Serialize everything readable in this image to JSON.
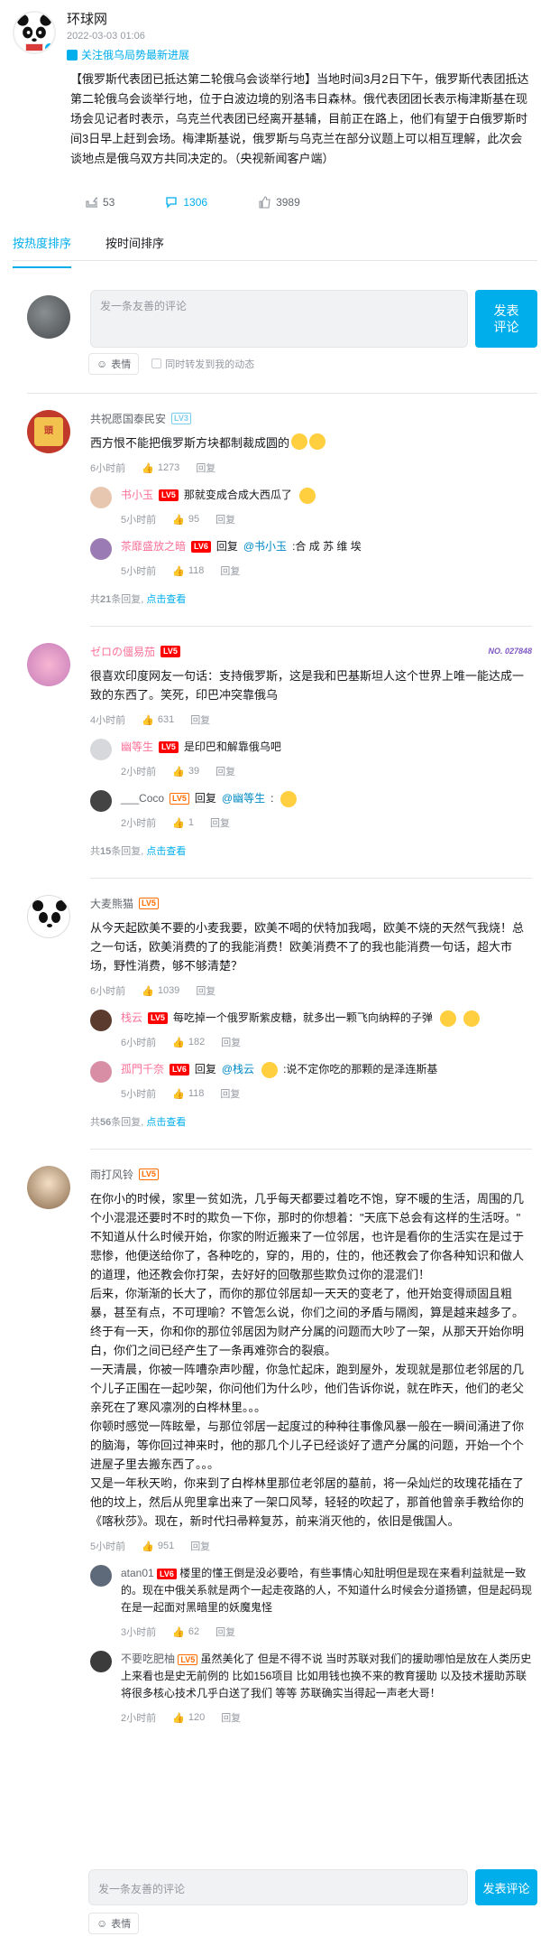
{
  "post": {
    "author": "环球网",
    "time": "2022-03-03 01:06",
    "follow_tip": "关注俄乌局势最新进展",
    "content": "【俄罗斯代表团已抵达第二轮俄乌会谈举行地】当地时间3月2日下午，俄罗斯代表团抵达第二轮俄乌会谈举行地，位于白波边境的别洛韦日森林。俄代表团团长表示梅津斯基在现场会见记者时表示，乌克兰代表团已经离开基辅，目前正在路上，他们有望于白俄罗斯时间3日早上赶到会场。梅津斯基说，俄罗斯与乌克兰在部分议题上可以相互理解，此次会谈地点是俄乌双方共同决定的。（央视新闻客户端）",
    "forward_count": "53",
    "comment_count": "1306",
    "like_count": "3989"
  },
  "tabs": [
    "按热度排序",
    "按时间排序"
  ],
  "editor": {
    "placeholder": "发一条友善的评论",
    "send_label": "发表评论",
    "emoji_label": "表情",
    "sync_label": "同时转发到我的动态"
  },
  "comments": [
    {
      "user": "共祝愿国泰民安",
      "level": "LV3",
      "text": "西方恨不能把俄罗斯方块都制裁成圆的",
      "time": "6小时前",
      "likes": "1273",
      "reply_label": "回复",
      "replies": [
        {
          "user": "书小玉",
          "level": "LV5",
          "text": "那就变成合成大西瓜了",
          "time": "5小时前",
          "likes": "95",
          "reply_label": "回复"
        },
        {
          "user": "茶靡盛放之暗",
          "level": "LV6",
          "prefix": "回复",
          "at": "@书小玉",
          "text": ":合 成 苏 维 埃",
          "time": "5小时前",
          "likes": "118",
          "reply_label": "回复"
        }
      ],
      "more_prefix": "共",
      "more_count": "21",
      "more_suffix": "条回复,",
      "more_link": "点击查看"
    },
    {
      "user": "ゼロの僵易茄",
      "level": "LV5",
      "badge": "NO. 027848",
      "text": "很喜欢印度网友一句话：支持俄罗斯，这是我和巴基斯坦人这个世界上唯一能达成一致的东西了。笑死，印巴冲突靠俄乌",
      "time": "4小时前",
      "likes": "631",
      "reply_label": "回复",
      "replies": [
        {
          "user": "幽等生",
          "level": "LV5",
          "text": "是印巴和解靠俄乌吧",
          "time": "2小时前",
          "likes": "39",
          "reply_label": "回复"
        },
        {
          "user": "___Coco",
          "level": "LV5",
          "prefix": "回复",
          "at": "@幽等生",
          "text": ":",
          "time": "2小时前",
          "likes": "1",
          "reply_label": "回复"
        }
      ],
      "more_prefix": "共",
      "more_count": "15",
      "more_suffix": "条回复,",
      "more_link": "点击查看"
    },
    {
      "user": "大麦熊猫",
      "level": "LV5",
      "text": "从今天起欧美不要的小麦我要，欧美不喝的伏特加我喝，欧美不烧的天然气我烧！总之一句话，欧美消费的了的我能消费！欧美消费不了的我也能消费一句话，超大市场，野性消费，够不够清楚？",
      "time": "6小时前",
      "likes": "1039",
      "reply_label": "回复",
      "replies": [
        {
          "user": "栈云",
          "level": "LV5",
          "text": "每吃掉一个俄罗斯紫皮糖，就多出一颗飞向纳粹的子弹",
          "time": "6小时前",
          "likes": "182",
          "reply_label": "回复"
        },
        {
          "user": "孤門千奈",
          "level": "LV6",
          "prefix": "回复",
          "at": "@栈云",
          "text": ":说不定你吃的那颗的是泽连斯基",
          "time": "5小时前",
          "likes": "118",
          "reply_label": "回复"
        }
      ],
      "more_prefix": "共",
      "more_count": "56",
      "more_suffix": "条回复,",
      "more_link": "点击查看"
    },
    {
      "user": "雨打风铃",
      "level": "LV5",
      "text": "在你小的时候，家里一贫如洗，几乎每天都要过着吃不饱，穿不暖的生活，周围的几个小混混还要时不时的欺负一下你，那时的你想着：\"天底下总会有这样的生活呀。\"\n不知道从什么时候开始，你家的附近搬来了一位邻居，也许是看你的生活实在是过于悲惨，他便送给你了，各种吃的，穿的，用的，住的，他还教会了你各种知识和做人的道理，他还教会你打架，去好好的回敬那些欺负过你的混混们！\n后来，你渐渐的长大了，而你的那位邻居却一天天的变老了，他开始变得顽固且粗暴，甚至有点，不可理喻？不管怎么说，你们之间的矛盾与隔阂，算是越来越多了。\n终于有一天，你和你的那位邻居因为财产分属的问题而大吵了一架，从那天开始你明白，你们之间已经产生了一条再难弥合的裂痕。\n一天清晨，你被一阵嘈杂声吵醒，你急忙起床，跑到屋外，发现就是那位老邻居的几个儿子正围在一起吵架，你问他们为什么吵，他们告诉你说，就在昨天，他们的老父亲死在了寒风凛冽的白桦林里。。。\n你顿时感觉一阵眩晕，与那位邻居一起度过的种种往事像风暴一般在一瞬间涌进了你的脑海，等你回过神来时，他的那几个儿子已经谈好了遗产分属的问题，开始一个个进屋子里去搬东西了。。。\n又是一年秋天哟，你来到了白桦林里那位老邻居的墓前，将一朵灿烂的玫瑰花插在了他的坟上，然后从兜里拿出来了一架口风琴，轻轻的吹起了，那首他曾亲手教给你的《喀秋莎》。现在，新时代扫帚粹复苏，前来消灭他的，依旧是俄国人。",
      "time": "5小时前",
      "likes": "951",
      "reply_label": "回复",
      "replies": [
        {
          "user": "atan01",
          "level": "LV6",
          "text": "楼里的懂王倒是没必要哈，有些事情心知肚明但是现在来看利益就是一致的。现在中俄关系就是两个一起走夜路的人，不知道什么时候会分道扬镳，但是起码现在是一起面对黑暗里的妖魔鬼怪",
          "time": "3小时前",
          "likes": "62",
          "reply_label": "回复"
        },
        {
          "user": "不要吃肥柚",
          "level": "LV5",
          "text": "虽然美化了 但是不得不说 当时苏联对我们的援助哪怕是放在人类历史上来看也是史无前例的 比如156项目 比如用钱也换不来的教育援助 以及技术援助苏联将很多核心技术几乎白送了我们 等等 苏联确实当得起一声老大哥！",
          "time": "2小时前",
          "likes": "120",
          "reply_label": "回复"
        }
      ]
    }
  ],
  "bottom_editor": {
    "placeholder": "发一条友善的评论",
    "send_label": "发表评论",
    "emoji_label": "表情"
  },
  "colors": {
    "accent": "#00aeec",
    "vip_name": "#fb7299",
    "text": "#18191c",
    "muted": "#9499a0"
  }
}
